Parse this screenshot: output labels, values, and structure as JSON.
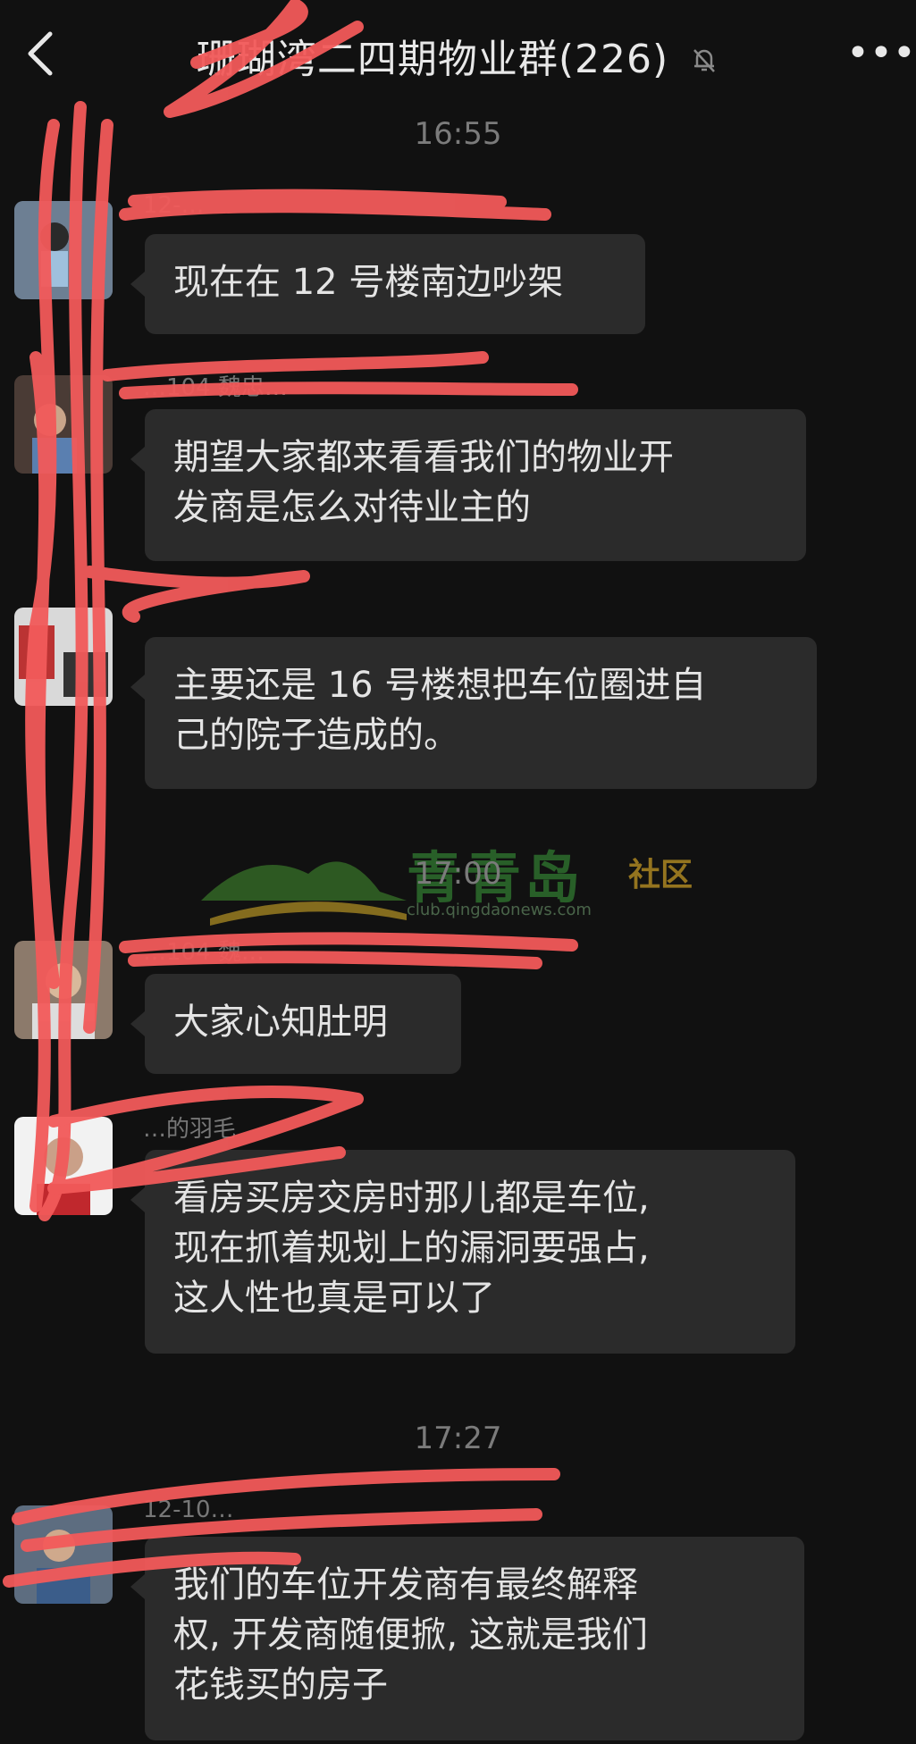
{
  "header": {
    "back_icon": "chevron-left-icon",
    "title": "珊瑚湾二四期物业群(226)",
    "mute_icon": "bell-off-icon",
    "more_label": "•••"
  },
  "timestamps": [
    "16:55",
    "17:00",
    "17:27"
  ],
  "messages": [
    {
      "sender": "12-…",
      "text": [
        "现在在 12 号楼南边吵架"
      ]
    },
    {
      "sender": "…104 魏忠…",
      "text": [
        "期望大家都来看看我们的物业开",
        "发商是怎么对待业主的"
      ]
    },
    {
      "sender": "",
      "text": [
        "主要还是 16 号楼想把车位圈进自",
        "己的院子造成的。"
      ]
    },
    {
      "sender": "…104 魏…",
      "text": [
        "大家心知肚明"
      ]
    },
    {
      "sender": "…的羽毛",
      "text": [
        "看房买房交房时那儿都是车位,",
        "现在抓着规划上的漏洞要强占,",
        "这人性也真是可以了"
      ]
    },
    {
      "sender": "12-10…",
      "text": [
        "我们的车位开发商有最终解释",
        "权, 开发商随便掀, 这就是我们",
        "花钱买的房子"
      ]
    }
  ],
  "watermark": {
    "name": "青青岛",
    "tag": "社区",
    "url": "club.qingdaonews.com"
  },
  "colors": {
    "background": "#111111",
    "bubble": "#2b2b2b",
    "scribble": "#f25a5a"
  }
}
